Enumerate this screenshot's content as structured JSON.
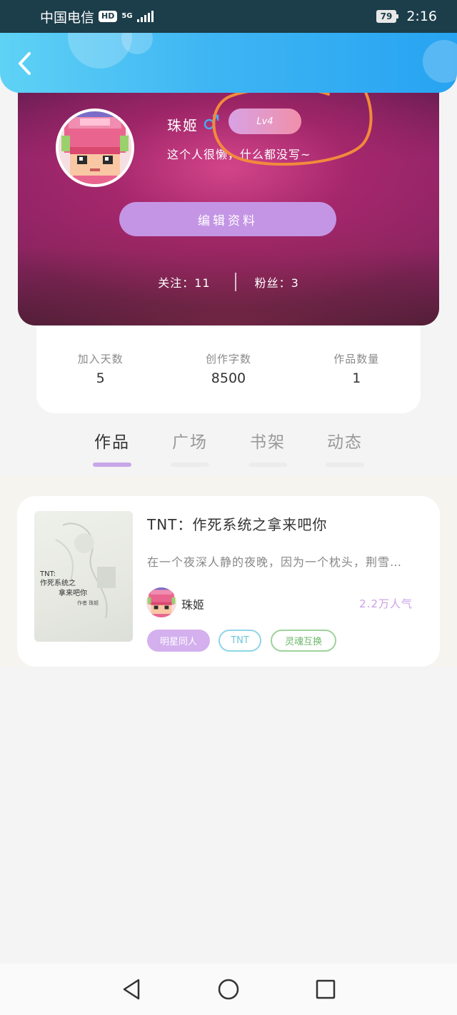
{
  "status_bar": {
    "carrier": "中国电信",
    "hd": "HD",
    "network": "5G",
    "battery": "79",
    "time": "2:16"
  },
  "profile": {
    "name": "珠姬",
    "level": "Lv4",
    "bio": "这个人很懒，什么都没写~",
    "edit_label": "编辑资料",
    "follow_label": "关注：",
    "follow_count": "11",
    "fans_label": "粉丝：",
    "fans_count": "3"
  },
  "stats": [
    {
      "label": "加入天数",
      "value": "5"
    },
    {
      "label": "创作字数",
      "value": "8500"
    },
    {
      "label": "作品数量",
      "value": "1"
    }
  ],
  "tabs": [
    {
      "label": "作品",
      "active": true
    },
    {
      "label": "广场",
      "active": false
    },
    {
      "label": "书架",
      "active": false
    },
    {
      "label": "动态",
      "active": false
    }
  ],
  "work": {
    "title": "TNT：作死系统之拿来吧你",
    "desc": "在一个夜深人静的夜晚，因为一个枕头，荆雪…",
    "author": "珠姬",
    "popularity": "2.2万人气",
    "cover_line1": "TNT:",
    "cover_line2": "作死系统之",
    "cover_line3": "拿来吧你",
    "cover_author": "作者  珠姬",
    "tags": [
      "明星同人",
      "TNT",
      "灵魂互换"
    ]
  },
  "colors": {
    "header_blue": "#3fb6f3",
    "accent_purple": "#c495e4",
    "tab_active_underline": "#c8a6e8",
    "scribble_orange": "#f28a3c"
  }
}
